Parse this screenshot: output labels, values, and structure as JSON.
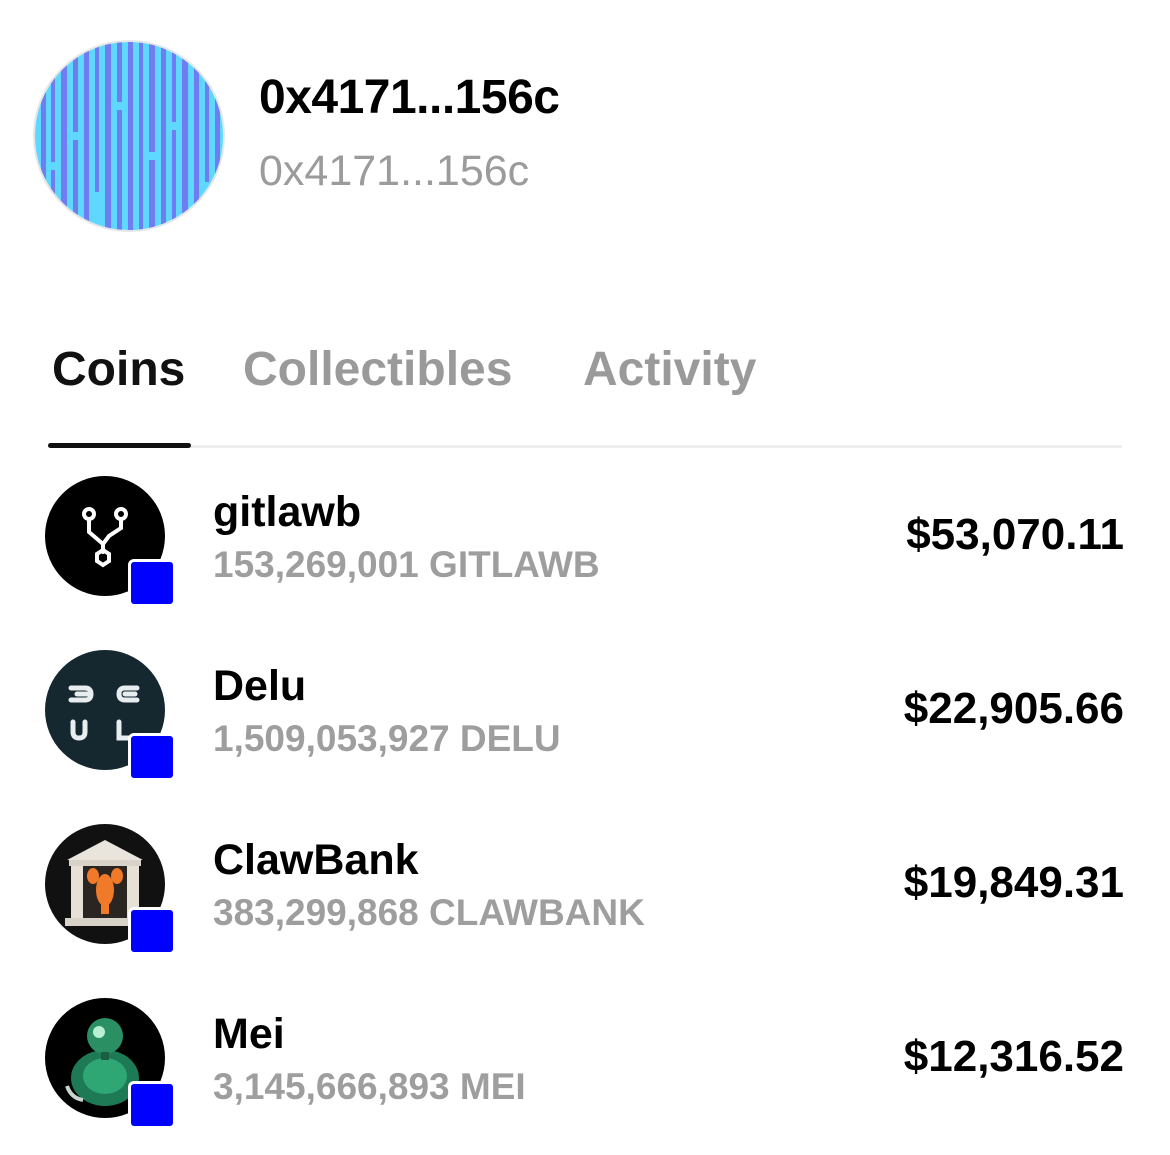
{
  "profile": {
    "address_title": "0x4171...156c",
    "address_subtitle": "0x4171...156c",
    "avatar_icon": "striped-identicon",
    "avatar_colors": [
      "#5fd8ff",
      "#6f7cf2"
    ]
  },
  "tabs": [
    {
      "label": "Coins",
      "active": true
    },
    {
      "label": "Collectibles",
      "active": false
    },
    {
      "label": "Activity",
      "active": false
    }
  ],
  "coins": [
    {
      "name": "gitlawb",
      "balance": "153,269,001 GITLAWB",
      "value": "$53,070.11",
      "icon": "git-branch-icon",
      "chain_badge_color": "#0000ff"
    },
    {
      "name": "Delu",
      "balance": "1,509,053,927 DELU",
      "value": "$22,905.66",
      "icon": "delu-logo-icon",
      "chain_badge_color": "#0000ff"
    },
    {
      "name": "ClawBank",
      "balance": "383,299,868 CLAWBANK",
      "value": "$19,849.31",
      "icon": "clawbank-lobster-icon",
      "chain_badge_color": "#0000ff"
    },
    {
      "name": "Mei",
      "balance": "3,145,666,893 MEI",
      "value": "$12,316.52",
      "icon": "mei-robot-icon",
      "chain_badge_color": "#0000ff"
    }
  ],
  "colors": {
    "primary_text": "#000000",
    "secondary_text": "#9b9b9b",
    "inactive_tab": "#9a9a9a",
    "chain_badge": "#0000ff"
  }
}
